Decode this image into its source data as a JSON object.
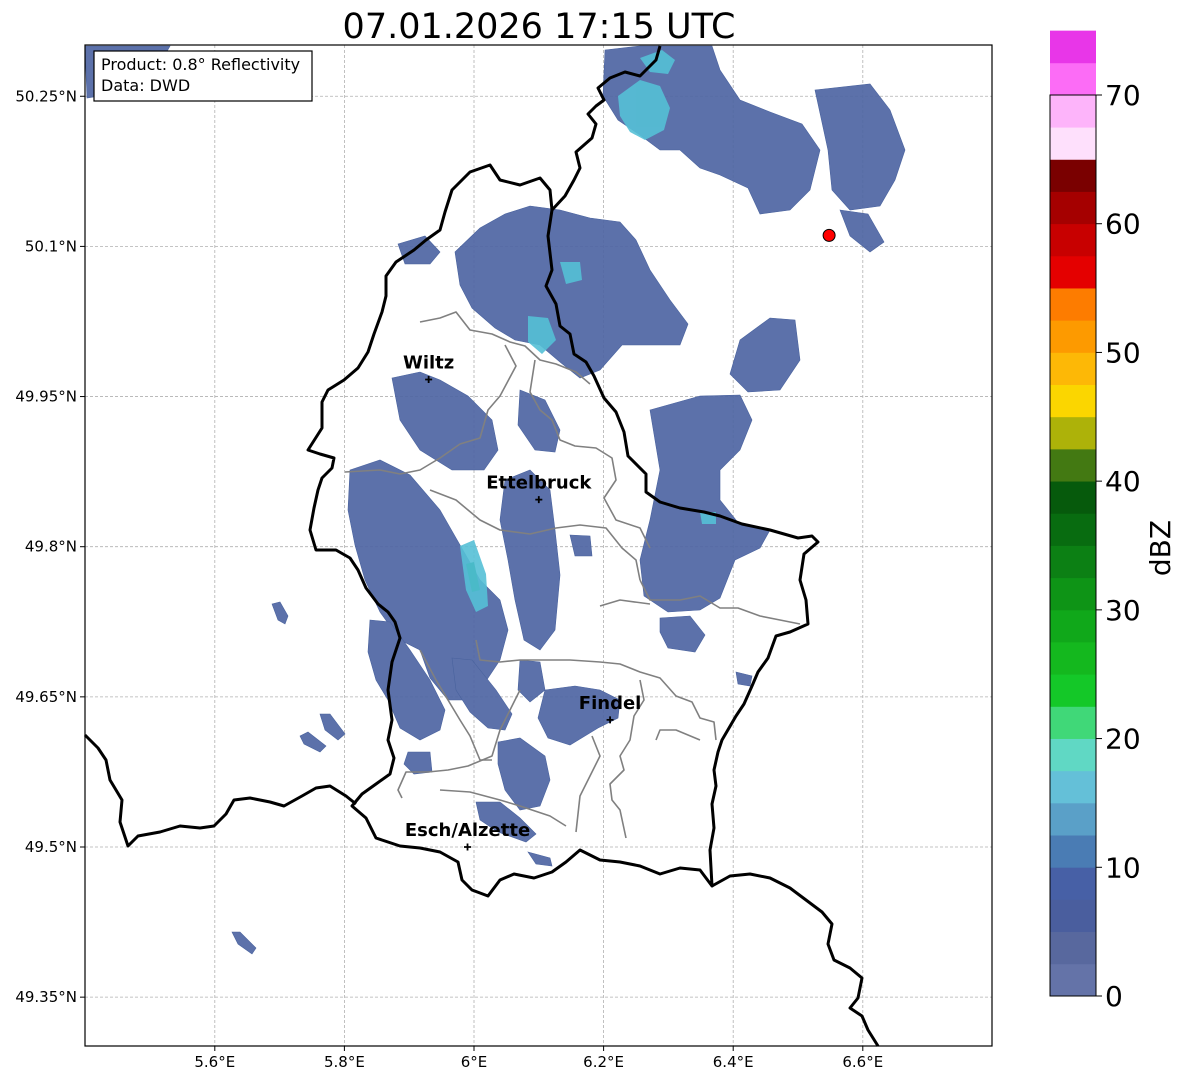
{
  "title": "07.01.2026 17:15 UTC",
  "info_box": {
    "product": "Product: 0.8° Reflectivity",
    "data": "Data: DWD"
  },
  "map": {
    "extent": {
      "lon_min": 5.4,
      "lon_max": 6.8,
      "lat_min": 49.3,
      "lat_max": 50.3
    },
    "lon_ticks": [
      {
        "value": 5.6,
        "label": "5.6°E"
      },
      {
        "value": 5.8,
        "label": "5.8°E"
      },
      {
        "value": 6.0,
        "label": "6°E"
      },
      {
        "value": 6.2,
        "label": "6.2°E"
      },
      {
        "value": 6.4,
        "label": "6.4°E"
      },
      {
        "value": 6.6,
        "label": "6.6°E"
      }
    ],
    "lat_ticks": [
      {
        "value": 50.25,
        "label": "50.25°N"
      },
      {
        "value": 50.1,
        "label": "50.1°N"
      },
      {
        "value": 49.95,
        "label": "49.95°N"
      },
      {
        "value": 49.8,
        "label": "49.8°N"
      },
      {
        "value": 49.65,
        "label": "49.65°N"
      },
      {
        "value": 49.5,
        "label": "49.5°N"
      },
      {
        "value": 49.35,
        "label": "49.35°N"
      }
    ],
    "cities": [
      {
        "name": "Wiltz",
        "lon": 5.93,
        "lat": 49.967
      },
      {
        "name": "Ettelbruck",
        "lon": 6.1,
        "lat": 49.847
      },
      {
        "name": "Findel",
        "lon": 6.21,
        "lat": 49.627
      },
      {
        "name": "Esch/Alzette",
        "lon": 5.99,
        "lat": 49.5
      }
    ],
    "radar_site": {
      "lon": 6.548,
      "lat": 50.111,
      "color": "#ff0000"
    },
    "colors": {
      "border": "#000000",
      "canton_border": "#808080",
      "grid": "#b0b0b0",
      "background": "#ffffff"
    }
  },
  "colorbar": {
    "label": "dBZ",
    "min": 0,
    "max": 70,
    "step": 2.5,
    "ticks": [
      "0",
      "10",
      "20",
      "30",
      "40",
      "50",
      "60",
      "70"
    ],
    "colors": [
      "#6473a8",
      "#58689e",
      "#4a5e9e",
      "#4760a6",
      "#4a7cb4",
      "#5aa0c8",
      "#64c0d8",
      "#60d8c4",
      "#40d878",
      "#14c828",
      "#14b81e",
      "#10a81a",
      "#0e9416",
      "#0c8014",
      "#086c10",
      "#065a0c",
      "#437912",
      "#adb209",
      "#fbd600",
      "#fdb806",
      "#fd9a00",
      "#fd7c00",
      "#e40000",
      "#c80000",
      "#a50000",
      "#7a0000",
      "#fee0fc",
      "#fdb4fa",
      "#fc6cf6",
      "#e836e8"
    ]
  }
}
